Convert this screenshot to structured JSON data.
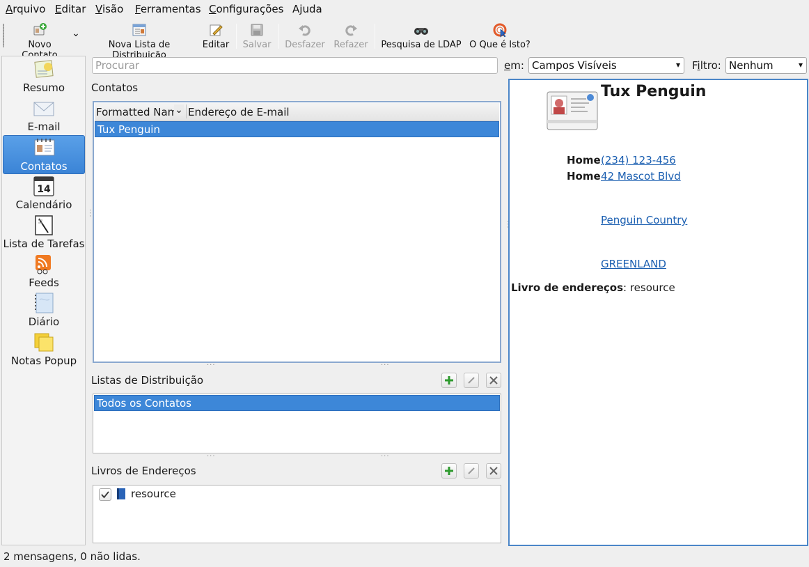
{
  "menubar": {
    "items": [
      {
        "label": "Arquivo",
        "mnemonic_index": 0
      },
      {
        "label": "Editar",
        "mnemonic_index": 0
      },
      {
        "label": "Visão",
        "mnemonic_index": 0
      },
      {
        "label": "Ferramentas",
        "mnemonic_index": 0
      },
      {
        "label": "Configurações",
        "mnemonic_index": 0
      },
      {
        "label": "Ajuda",
        "mnemonic_index": 1
      }
    ]
  },
  "toolbar": {
    "new_contact": "Novo Contato",
    "new_list": "Nova Lista de Distribuição",
    "edit": "Editar",
    "save": "Salvar",
    "undo": "Desfazer",
    "redo": "Refazer",
    "ldap": "Pesquisa de LDAP",
    "whats_this": "O Que é Isto?"
  },
  "sidebar": {
    "items": [
      {
        "label": "Resumo",
        "icon": "summary-icon"
      },
      {
        "label": "E-mail",
        "icon": "mail-icon"
      },
      {
        "label": "Contatos",
        "icon": "contacts-icon",
        "active": true
      },
      {
        "label": "Calendário",
        "icon": "calendar-icon"
      },
      {
        "label": "Lista de Tarefas",
        "icon": "todo-icon"
      },
      {
        "label": "Feeds",
        "icon": "feeds-icon"
      },
      {
        "label": "Diário",
        "icon": "journal-icon"
      },
      {
        "label": "Notas Popup",
        "icon": "notes-icon"
      }
    ],
    "calendar_day": "14"
  },
  "search": {
    "placeholder": "Procurar"
  },
  "filter_bar": {
    "in_label": "em:",
    "in_value": "Campos Visíveis",
    "filter_label": "Filtro:",
    "filter_value": "Nenhum"
  },
  "contacts": {
    "title": "Contatos",
    "columns": [
      "Formatted Nam",
      "Endereço de E-mail"
    ],
    "rows": [
      {
        "name": "Tux Penguin",
        "email": ""
      }
    ]
  },
  "distribution_lists": {
    "title": "Listas de Distribuição",
    "items": [
      "Todos os Contatos"
    ]
  },
  "address_books": {
    "title": "Livros de Endereços",
    "items": [
      {
        "label": "resource",
        "checked": true
      }
    ]
  },
  "detail": {
    "name": "Tux Penguin",
    "phone_label": "Home",
    "phone": "(234) 123-456",
    "address_label": "Home",
    "address_street": "42 Mascot Blvd",
    "address_region": "Penguin Country",
    "address_country": "GREENLAND",
    "book_label": "Livro de endereços",
    "book_value": ": resource"
  },
  "status": {
    "text": "2 mensagens, 0 não lidas."
  },
  "colors": {
    "selection": "#3d87d8",
    "link": "#1b5fb1",
    "panel_border": "#8aa8cf"
  }
}
